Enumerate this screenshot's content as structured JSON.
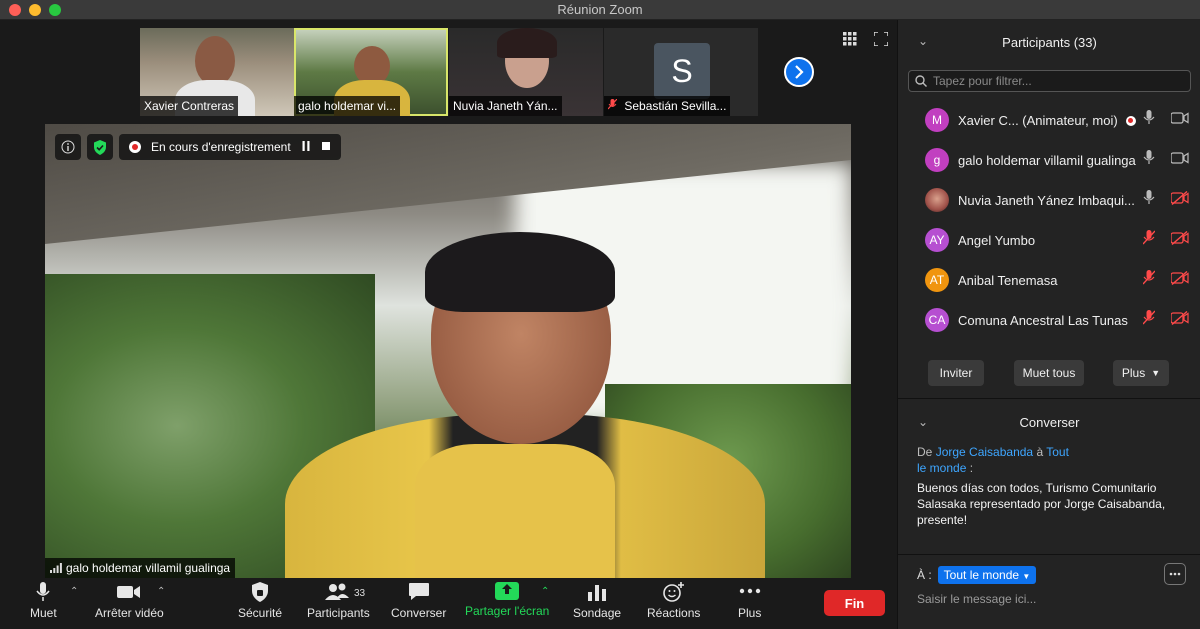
{
  "window": {
    "title": "Réunion Zoom"
  },
  "thumbnails": [
    {
      "name": "Xavier Contreras",
      "muted": false,
      "active": false
    },
    {
      "name": "galo holdemar vi...",
      "muted": false,
      "active": true
    },
    {
      "name": "Nuvia Janeth Yán...",
      "muted": false,
      "active": false
    },
    {
      "name": "Sebastián Sevilla...",
      "muted": true,
      "active": false,
      "avatar_letter": "S"
    }
  ],
  "recording": {
    "label": "En cours d'enregistrement"
  },
  "main_video": {
    "speaker_name": "galo holdemar villamil gualinga"
  },
  "toolbar": {
    "mute_label": "Muet",
    "video_label": "Arrêter vidéo",
    "security_label": "Sécurité",
    "participants_label": "Participants",
    "participants_count": "33",
    "chat_label": "Converser",
    "share_label": "Partager l'écran",
    "poll_label": "Sondage",
    "reactions_label": "Réactions",
    "more_label": "Plus",
    "end_label": "Fin"
  },
  "participants_panel": {
    "title": "Participants (33)",
    "filter_placeholder": "Tapez pour filtrer...",
    "list": [
      {
        "initials": "M",
        "color": "#c13fc0",
        "name": "Xavier C...  (Animateur, moi)",
        "mic_muted": false,
        "cam_off": false,
        "recording": true
      },
      {
        "initials": "g",
        "color": "#c13fc0",
        "name": "galo holdemar villamil gualinga",
        "mic_muted": false,
        "cam_off": false,
        "recording": false
      },
      {
        "initials": "",
        "color": "#7a3a3a",
        "name": "Nuvia Janeth Yánez Imbaqui...",
        "mic_muted": false,
        "cam_off": true,
        "recording": false
      },
      {
        "initials": "AY",
        "color": "#b64fd1",
        "name": "Angel Yumbo",
        "mic_muted": true,
        "cam_off": true,
        "recording": false
      },
      {
        "initials": "AT",
        "color": "#f0950f",
        "name": "Anibal Tenemasa",
        "mic_muted": true,
        "cam_off": true,
        "recording": false
      },
      {
        "initials": "CA",
        "color": "#b64fd1",
        "name": "Comuna Ancestral Las Tunas",
        "mic_muted": true,
        "cam_off": true,
        "recording": false
      }
    ],
    "invite_label": "Inviter",
    "mute_all_label": "Muet tous",
    "more_label": "Plus"
  },
  "chat_panel": {
    "title": "Converser",
    "from_prefix": "De",
    "from_name": "Jorge Caisabanda",
    "to_word": "à",
    "to_name_1": "Tout",
    "to_name_2": "le monde",
    "from_suffix": " :",
    "message": "Buenos días con todos,  Turismo Comunitario Salasaka representado por Jorge Caisabanda, presente!",
    "to_label": "À :",
    "to_value": "Tout le monde",
    "input_placeholder": "Saisir le message ici..."
  },
  "colors": {
    "accent": "#0e72ed",
    "end": "#e02828",
    "share": "#23d959",
    "muted": "#ff4a4a"
  }
}
